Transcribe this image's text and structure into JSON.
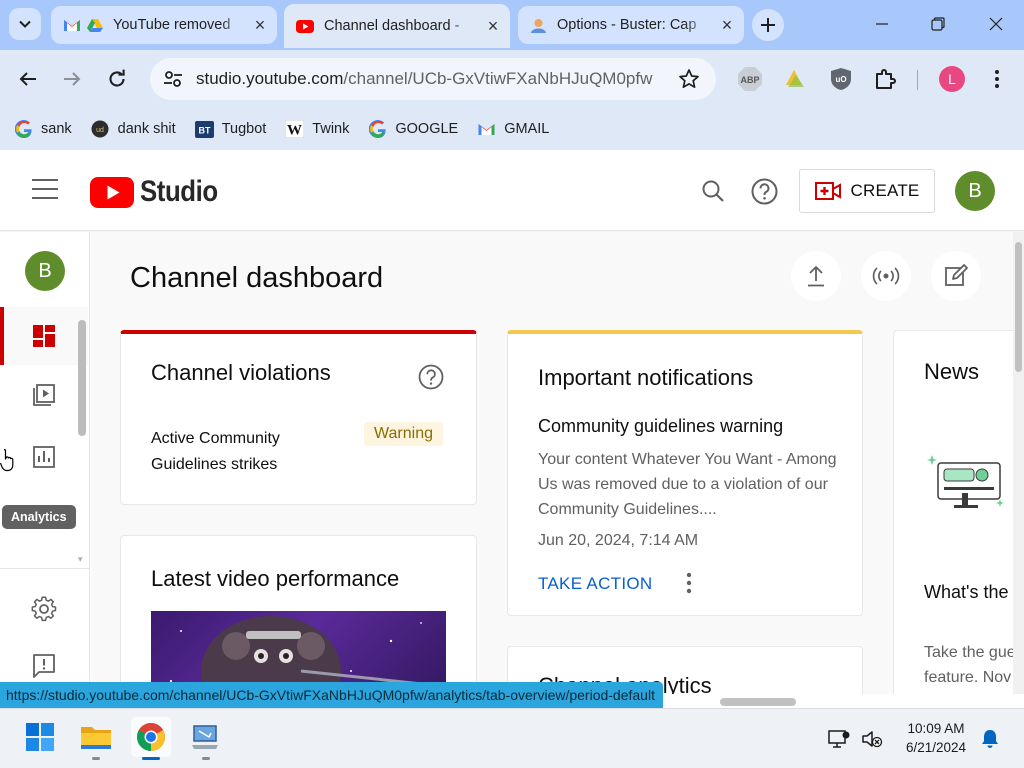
{
  "browser": {
    "tabs": [
      {
        "label": "YouTube removed",
        "active": false
      },
      {
        "label": "Channel dashboard -",
        "active": true
      },
      {
        "label": "Options - Buster: Cap",
        "active": false
      }
    ],
    "url_host": "studio.youtube.com",
    "url_path": "/channel/UCb-GxVtiwFXaNbHJuQM0pfw",
    "extensions": {
      "abp_label": "ABP",
      "profile_initial": "L"
    },
    "bookmarks": [
      {
        "label": "sank"
      },
      {
        "label": "dank shit"
      },
      {
        "label": "Tugbot"
      },
      {
        "label": "Twink"
      },
      {
        "label": "GOOGLE"
      },
      {
        "label": "GMAIL"
      }
    ],
    "status_url": "https://studio.youtube.com/channel/UCb-GxVtiwFXaNbHJuQM0pfw/analytics/tab-overview/period-default"
  },
  "studio": {
    "logo_text": "Studio",
    "create_label": "CREATE",
    "avatar_initial": "B",
    "tooltip": "Analytics",
    "page_title": "Channel dashboard",
    "violations": {
      "title": "Channel violations",
      "label": "Active Community Guidelines strikes",
      "chip": "Warning"
    },
    "notifications": {
      "title": "Important notifications",
      "subtitle": "Community guidelines warning",
      "body": "Your content Whatever You Want - Among Us was removed due to a violation of our Community Guidelines....",
      "date": "Jun 20, 2024, 7:14 AM",
      "action": "TAKE ACTION"
    },
    "latest": {
      "title": "Latest video performance"
    },
    "next_card_title": "Channel analytics",
    "news": {
      "title": "News",
      "headline": "What's the video?",
      "body": "Take the gue with the new feature. Nov"
    }
  },
  "taskbar": {
    "time": "10:09 AM",
    "date": "6/21/2024"
  },
  "colors": {
    "accent_red": "#cc0000",
    "link_blue": "#065fd4",
    "status_bar": "#2aa5dd",
    "avatar_green": "#5f8d2b"
  }
}
